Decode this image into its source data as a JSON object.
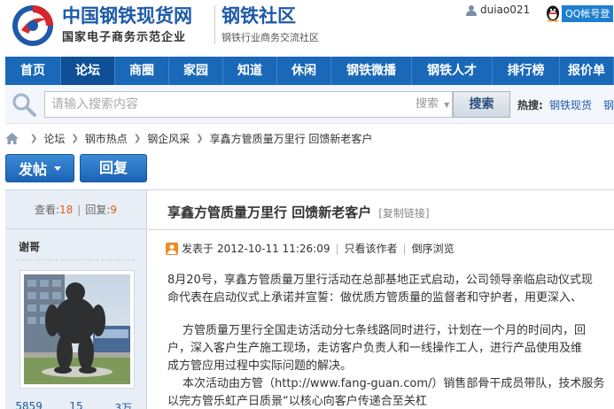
{
  "header": {
    "logo_title": "中国钢铁现货网",
    "logo_subtitle": "国家电子商务示范企业",
    "community_title": "钢铁社区",
    "community_subtitle": "钢铁行业商务交流社区",
    "username": "duiao021",
    "qq_label": "QQ帐号登"
  },
  "nav": {
    "items": [
      {
        "label": "首页",
        "w": 63
      },
      {
        "label": "论坛",
        "w": 61
      },
      {
        "label": "商圈",
        "w": 61
      },
      {
        "label": "家园",
        "w": 61
      },
      {
        "label": "知道",
        "w": 61
      },
      {
        "label": "休闲",
        "w": 61
      },
      {
        "label": "钢铁微播",
        "w": 91
      },
      {
        "label": "钢铁人才",
        "w": 91
      },
      {
        "label": "排行榜",
        "w": 76
      },
      {
        "label": "报价单",
        "w": 61
      }
    ]
  },
  "search": {
    "placeholder": "请输入搜索内容",
    "scope": "搜索",
    "button": "搜索",
    "hot_label": "热搜:",
    "hot_links": [
      "钢铁现货",
      "钢"
    ]
  },
  "breadcrumb": [
    "论坛",
    "钢市热点",
    "钢企风采",
    "享鑫方管质量万里行 回馈新老客户"
  ],
  "actions": {
    "post": "发帖",
    "reply": "回复"
  },
  "thread": {
    "views_label": "查看:",
    "views": "18",
    "replies_label": "回复:",
    "replies": "9",
    "author": "谢哥",
    "author_stats": [
      "5859",
      "15",
      "3万"
    ],
    "title": "享鑫方管质量万里行 回馈新老客户",
    "copy_link": "[复制链接]",
    "posted_label": "发表于",
    "posted_at": "2012-10-11 11:26:09",
    "author_only": "只看该作者",
    "reverse": "倒序浏览",
    "body": [
      "8月20号，享鑫方管质量万里行活动在总部基地正式启动，公司领导亲临启动仪式现",
      "命代表在启动仪式上承诺并宣誓：做优质方管质量的监督者和守护者，用更深入、",
      "方管质量万里行全国走访活动分七条线路同时进行，计划在一个月的时间内，回",
      "户，深入客户生产施工现场，走访客户负责人和一线操作工人，进行产品使用及维",
      "成方管应用过程中实际问题的解决。",
      "本次活动由方管（http://www.fang-guan.com/）销售部骨干成员带队，技术服务",
      "以完方管乐虹产日质景“以核心向客户传递合至关杠"
    ]
  }
}
